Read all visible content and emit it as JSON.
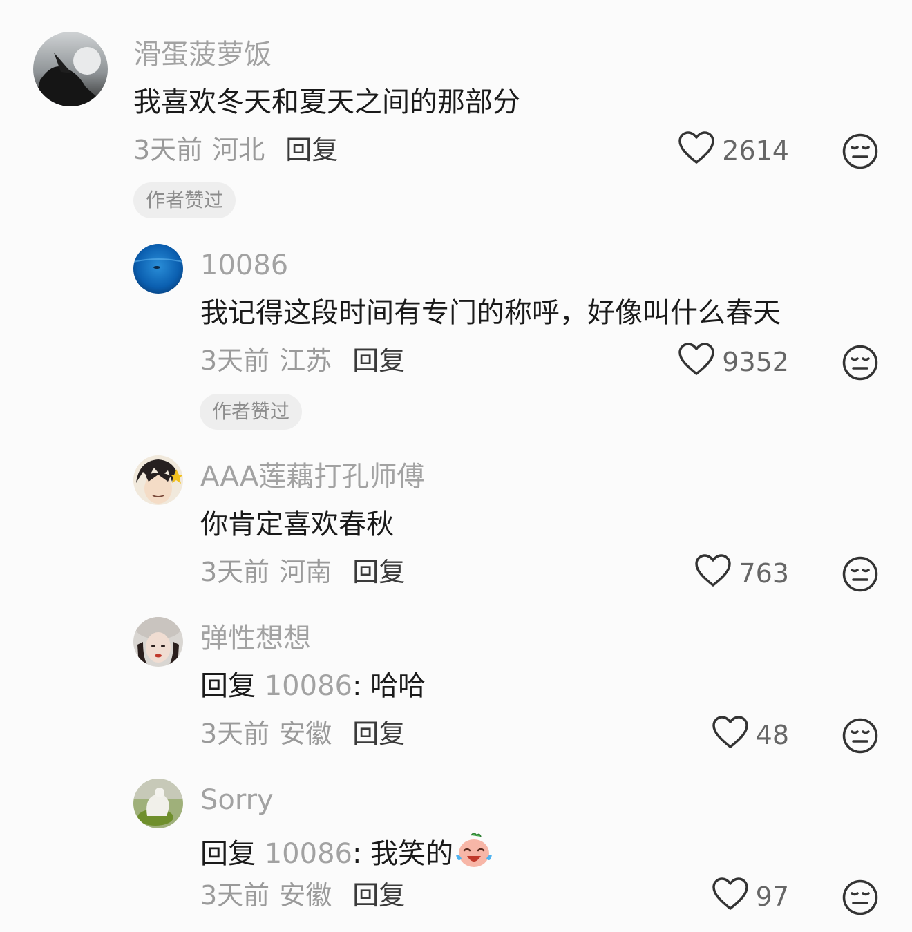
{
  "comments": [
    {
      "username": "滑蛋菠萝饭",
      "text": "我喜欢冬天和夏天之间的那部分",
      "time": "3天前",
      "location": "河北",
      "reply_label": "回复",
      "likes": "2614",
      "badge": "作者赞过"
    },
    {
      "username": "10086",
      "text": "我记得这段时间有专门的称呼，好像叫什么春天",
      "time": "3天前",
      "location": "江苏",
      "reply_label": "回复",
      "likes": "9352",
      "badge": "作者赞过"
    },
    {
      "username": "AAA莲藕打孔师傅",
      "text": "你肯定喜欢春秋",
      "time": "3天前",
      "location": "河南",
      "reply_label": "回复",
      "likes": "763"
    },
    {
      "username": "弹性想想",
      "reply_prefix": "回复 ",
      "mention": "10086",
      "text": ": 哈哈",
      "time": "3天前",
      "location": "安徽",
      "reply_label": "回复",
      "likes": "48"
    },
    {
      "username": "Sorry",
      "reply_prefix": "回复 ",
      "mention": "10086",
      "text": ": 我笑的",
      "emoji": "laughing-crying-emoji",
      "time": "3天前",
      "location": "安徽",
      "reply_label": "回复",
      "likes": "97"
    }
  ],
  "icons": {
    "like": "heart-outline-icon",
    "dislike": "neutral-face-icon"
  }
}
